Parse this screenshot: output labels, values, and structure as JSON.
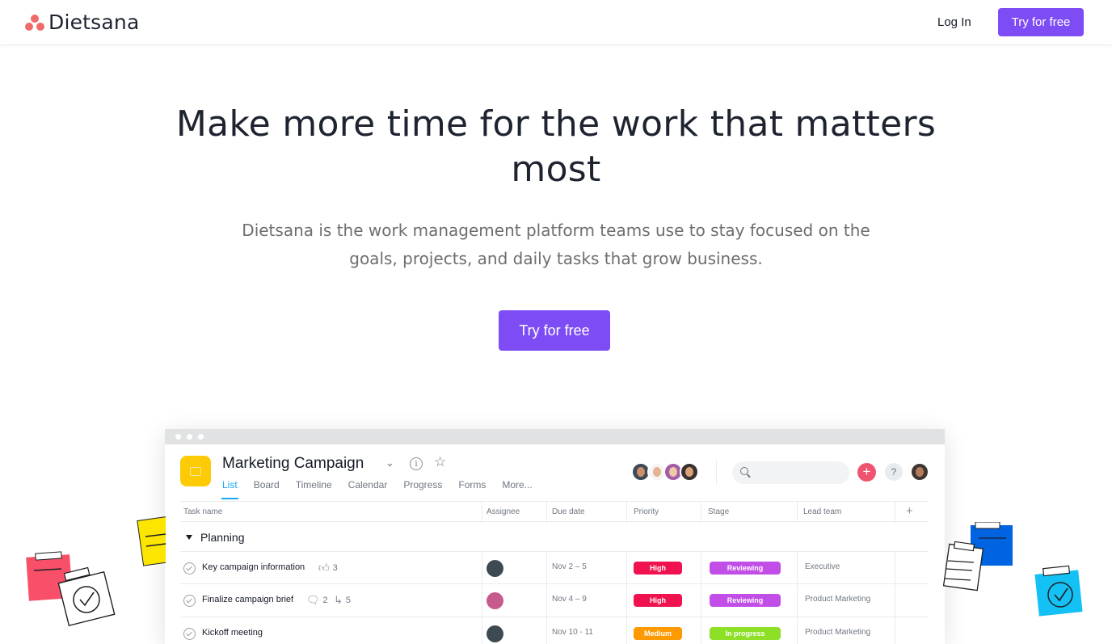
{
  "brand": {
    "name": "Dietsana",
    "logo_color": "#f06a6a"
  },
  "nav": {
    "login_label": "Log In",
    "cta_label": "Try for free",
    "accent": "#7e4cf5"
  },
  "hero": {
    "title": "Make more time for the work that matters most",
    "subtitle": "Dietsana is the work management platform teams use to stay focused on the goals, projects, and daily tasks that grow business.",
    "cta_label": "Try for free"
  },
  "app": {
    "project_title": "Marketing Campaign",
    "project_icon": "project-list-icon",
    "tabs": [
      "List",
      "Board",
      "Timeline",
      "Calendar",
      "Progress",
      "Forms",
      "More..."
    ],
    "active_tab": "List",
    "columns": [
      "Task name",
      "Assignee",
      "Due date",
      "Priority",
      "Stage",
      "Lead team"
    ],
    "section": "Planning",
    "rows": [
      {
        "task": "Key campaign information",
        "likes": "3",
        "comments": "",
        "subtasks": "",
        "due": "Nov 2 – 5",
        "priority": "High",
        "priority_color": "#f0114f",
        "stage": "Reviewing",
        "stage_color": "#c24ee8",
        "team": "Executive"
      },
      {
        "task": "Finalize campaign brief",
        "likes": "",
        "comments": "2",
        "subtasks": "5",
        "due": "Nov 4 – 9",
        "priority": "High",
        "priority_color": "#f0114f",
        "stage": "Reviewing",
        "stage_color": "#c24ee8",
        "team": "Product Marketing"
      },
      {
        "task": "Kickoff meeting",
        "likes": "",
        "comments": "",
        "subtasks": "",
        "due": "Nov 10 - 11",
        "priority": "Medium",
        "priority_color": "#fd9a00",
        "stage": "In progress",
        "stage_color": "#8ee027",
        "team": "Product Marketing"
      }
    ]
  }
}
